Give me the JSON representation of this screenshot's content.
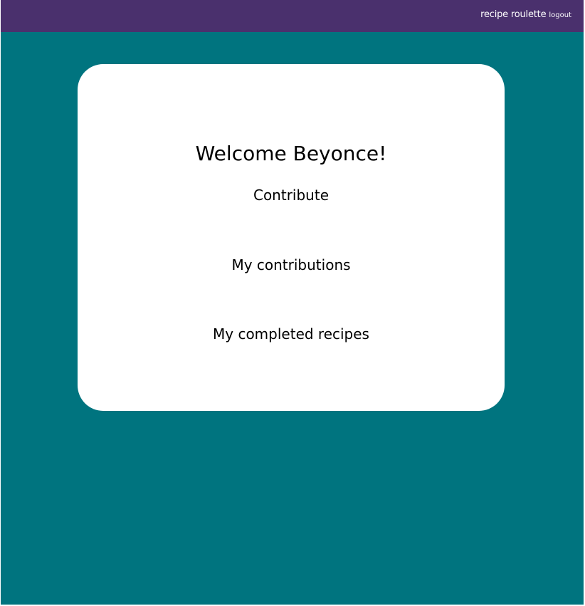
{
  "navbar": {
    "brand": "recipe roulette",
    "logout": "logout"
  },
  "card": {
    "welcome": "Welcome Beyonce!",
    "links": [
      {
        "label": "Contribute"
      },
      {
        "label": "My contributions"
      },
      {
        "label": "My completed recipes"
      }
    ]
  },
  "colors": {
    "navbar_bg": "#4a306d",
    "page_bg": "#00747f",
    "card_bg": "#ffffff",
    "text": "#000000"
  }
}
